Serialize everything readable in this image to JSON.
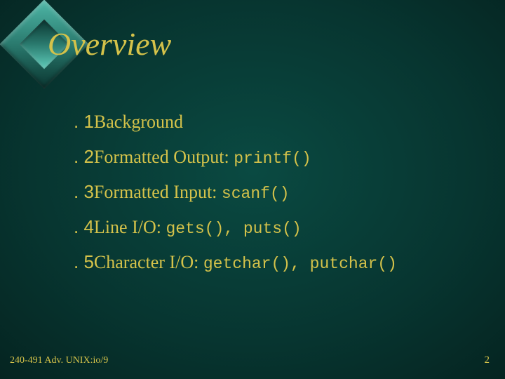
{
  "title": "Overview",
  "items": [
    {
      "num": ". 1",
      "text": "Background",
      "code": ""
    },
    {
      "num": ". 2",
      "text": "Formatted Output: ",
      "code": "printf()"
    },
    {
      "num": ". 3",
      "text": "Formatted Input: ",
      "code": "scanf()"
    },
    {
      "num": ". 4",
      "text": "Line I/O: ",
      "code": "gets(), puts()"
    },
    {
      "num": ". 5",
      "text": "Character I/O: ",
      "code": "getchar(), putchar()"
    }
  ],
  "footer": {
    "left": "240-491 Adv. UNIX:io/9",
    "right": "2"
  }
}
